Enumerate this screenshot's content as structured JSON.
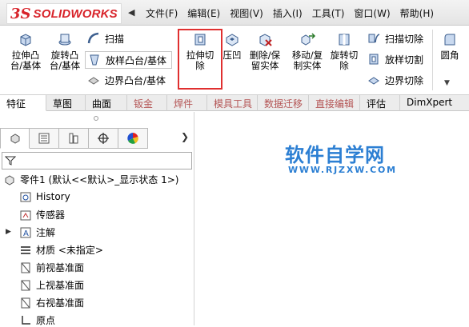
{
  "app": {
    "logo_mark": "3S",
    "logo_text": "SOLIDWORKS"
  },
  "menu": {
    "items": [
      {
        "label": "文件(F)"
      },
      {
        "label": "编辑(E)"
      },
      {
        "label": "视图(V)"
      },
      {
        "label": "插入(I)"
      },
      {
        "label": "工具(T)"
      },
      {
        "label": "窗口(W)"
      },
      {
        "label": "帮助(H)"
      }
    ]
  },
  "ribbon": {
    "extrude_boss": "拉伸凸\n台/基体",
    "revolve_boss": "旋转凸\n台/基体",
    "sweep": "扫描",
    "loft_boss": "放样凸台/基体",
    "boundary_boss": "边界凸台/基体",
    "extrude_cut": "拉伸切\n除",
    "indent": "压凹",
    "delete_keep_body": "删除/保\n留实体",
    "move_copy_body": "移动/复\n制实体",
    "revolve_cut": "旋转切\n除",
    "swept_cut": "扫描切除",
    "lofted_cut": "放样切割",
    "boundary_cut": "边界切除",
    "fillet": "圆角"
  },
  "tabs": [
    {
      "label": "特征"
    },
    {
      "label": "草图"
    },
    {
      "label": "曲面"
    },
    {
      "label": "钣金"
    },
    {
      "label": "焊件"
    },
    {
      "label": "模具工具"
    },
    {
      "label": "数据迁移"
    },
    {
      "label": "直接编辑"
    },
    {
      "label": "评估"
    },
    {
      "label": "DimXpert"
    }
  ],
  "tree": {
    "part": "零件1  (默认<<默认>_显示状态 1>)",
    "history": "History",
    "sensors": "传感器",
    "annotations": "注解",
    "material": "材质 <未指定>",
    "front_plane": "前视基准面",
    "top_plane": "上视基准面",
    "right_plane": "右视基准面",
    "origin": "原点"
  },
  "watermark": {
    "title": "软件自学网",
    "url": "WWW.RJZXW.COM"
  },
  "colors": {
    "brand_red": "#d8232a",
    "highlight": "#e03030",
    "watermark_blue": "#2c7fd3"
  }
}
